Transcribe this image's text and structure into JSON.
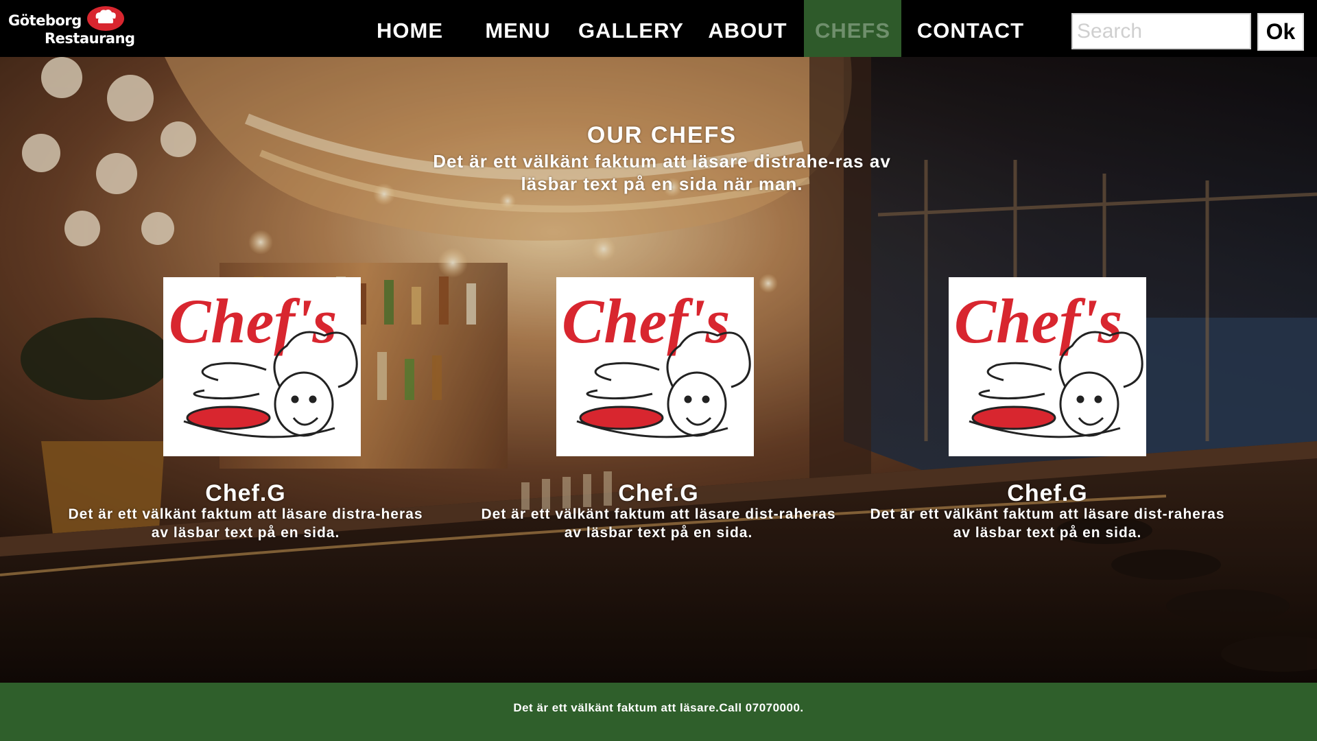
{
  "logo": {
    "line1": "Göteborg",
    "line2": "Restaurang"
  },
  "nav": {
    "items": [
      {
        "label": "HOME",
        "active": false
      },
      {
        "label": "MENU",
        "active": false
      },
      {
        "label": "GALLERY",
        "active": false
      },
      {
        "label": "ABOUT",
        "active": false
      },
      {
        "label": "CHEFS",
        "active": true
      },
      {
        "label": "CONTACT",
        "active": false
      }
    ],
    "active_color": "#2e5a2a"
  },
  "search": {
    "placeholder": "Search",
    "value": "",
    "button_label": "Ok"
  },
  "section": {
    "title": "OUR CHEFS",
    "intro": "Det är ett välkänt faktum att läsare distrahe-ras av läsbar text på en sida när man."
  },
  "chefs": [
    {
      "name": "Chef.G",
      "description": "Det är ett välkänt faktum att läsare distra-heras av läsbar text på en sida.",
      "image_logo": "Chef's",
      "icon": "chef-logo-icon"
    },
    {
      "name": "Chef.G",
      "description": "Det är ett välkänt faktum att läsare dist-raheras av läsbar text på en sida.",
      "image_logo": "Chef's",
      "icon": "chef-logo-icon"
    },
    {
      "name": "Chef.G",
      "description": "Det är ett välkänt faktum att läsare dist-raheras av läsbar text på en sida.",
      "image_logo": "Chef's",
      "icon": "chef-logo-icon"
    }
  ],
  "footer": {
    "text": "Det är ett välkänt faktum att läsare.Call 07070000."
  },
  "colors": {
    "header_bg": "#000000",
    "footer_bg": "#2f5f2b",
    "logo_red": "#d8262f"
  }
}
